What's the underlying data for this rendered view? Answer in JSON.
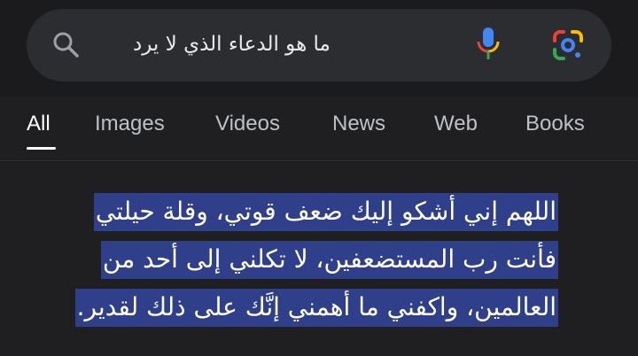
{
  "search": {
    "query": "ما هو الدعاء الذي لا يرد",
    "icons": {
      "left": "search-icon",
      "mic": "microphone-icon",
      "lens": "google-lens-icon"
    }
  },
  "tabs": [
    {
      "label": "All",
      "active": true
    },
    {
      "label": "Images",
      "active": false
    },
    {
      "label": "Videos",
      "active": false
    },
    {
      "label": "News",
      "active": false
    },
    {
      "label": "Web",
      "active": false
    },
    {
      "label": "Books",
      "active": false
    }
  ],
  "answer": {
    "highlighted": true,
    "lines": [
      "اللهم إني أشكو إليك ضعف قوتي، وقلة حيلتي",
      "فأنت رب المستضعفين، لا تكلني إلى أحد من",
      "العالمين، واكفني ما أهمني إنَّك على ذلك لقدير."
    ]
  },
  "colors": {
    "background": "#1f1f21",
    "search_bar": "#2c2d30",
    "highlight": "#2f3f8a",
    "text": "#ffffff",
    "tab_inactive": "#bdc1c6"
  }
}
